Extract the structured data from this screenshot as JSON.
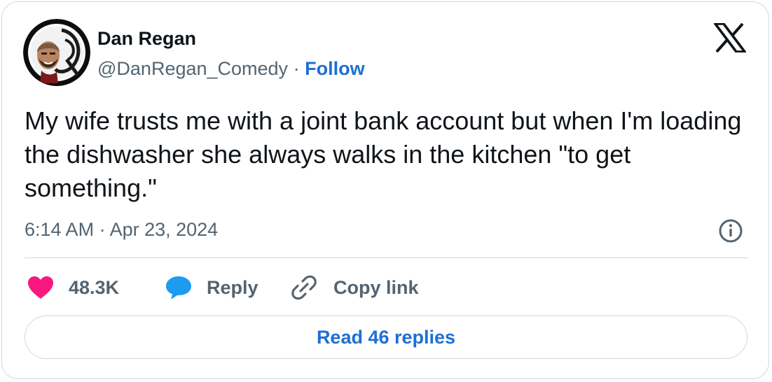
{
  "author": {
    "name": "Dan Regan",
    "handle": "@DanRegan_Comedy",
    "separator": "·",
    "follow_label": "Follow"
  },
  "tweet": {
    "text": "My wife trusts me with a joint bank account but when I'm loading the dishwasher she always walks in the kitchen \"to get something.\"",
    "timestamp": "6:14 AM · Apr 23, 2024"
  },
  "actions": {
    "like_count": "48.3K",
    "reply_label": "Reply",
    "copy_link_label": "Copy link"
  },
  "read_replies_label": "Read 46 replies",
  "icons": {
    "brand": "x-logo-icon",
    "info": "info-icon",
    "like": "heart-icon",
    "reply": "speech-bubble-icon",
    "copy": "link-icon"
  },
  "colors": {
    "text": "#0f1419",
    "secondary": "#536471",
    "link": "#1d6fd4",
    "heart": "#f91880",
    "reply_bubble": "#1d9bf0",
    "border": "#cfd9de"
  }
}
